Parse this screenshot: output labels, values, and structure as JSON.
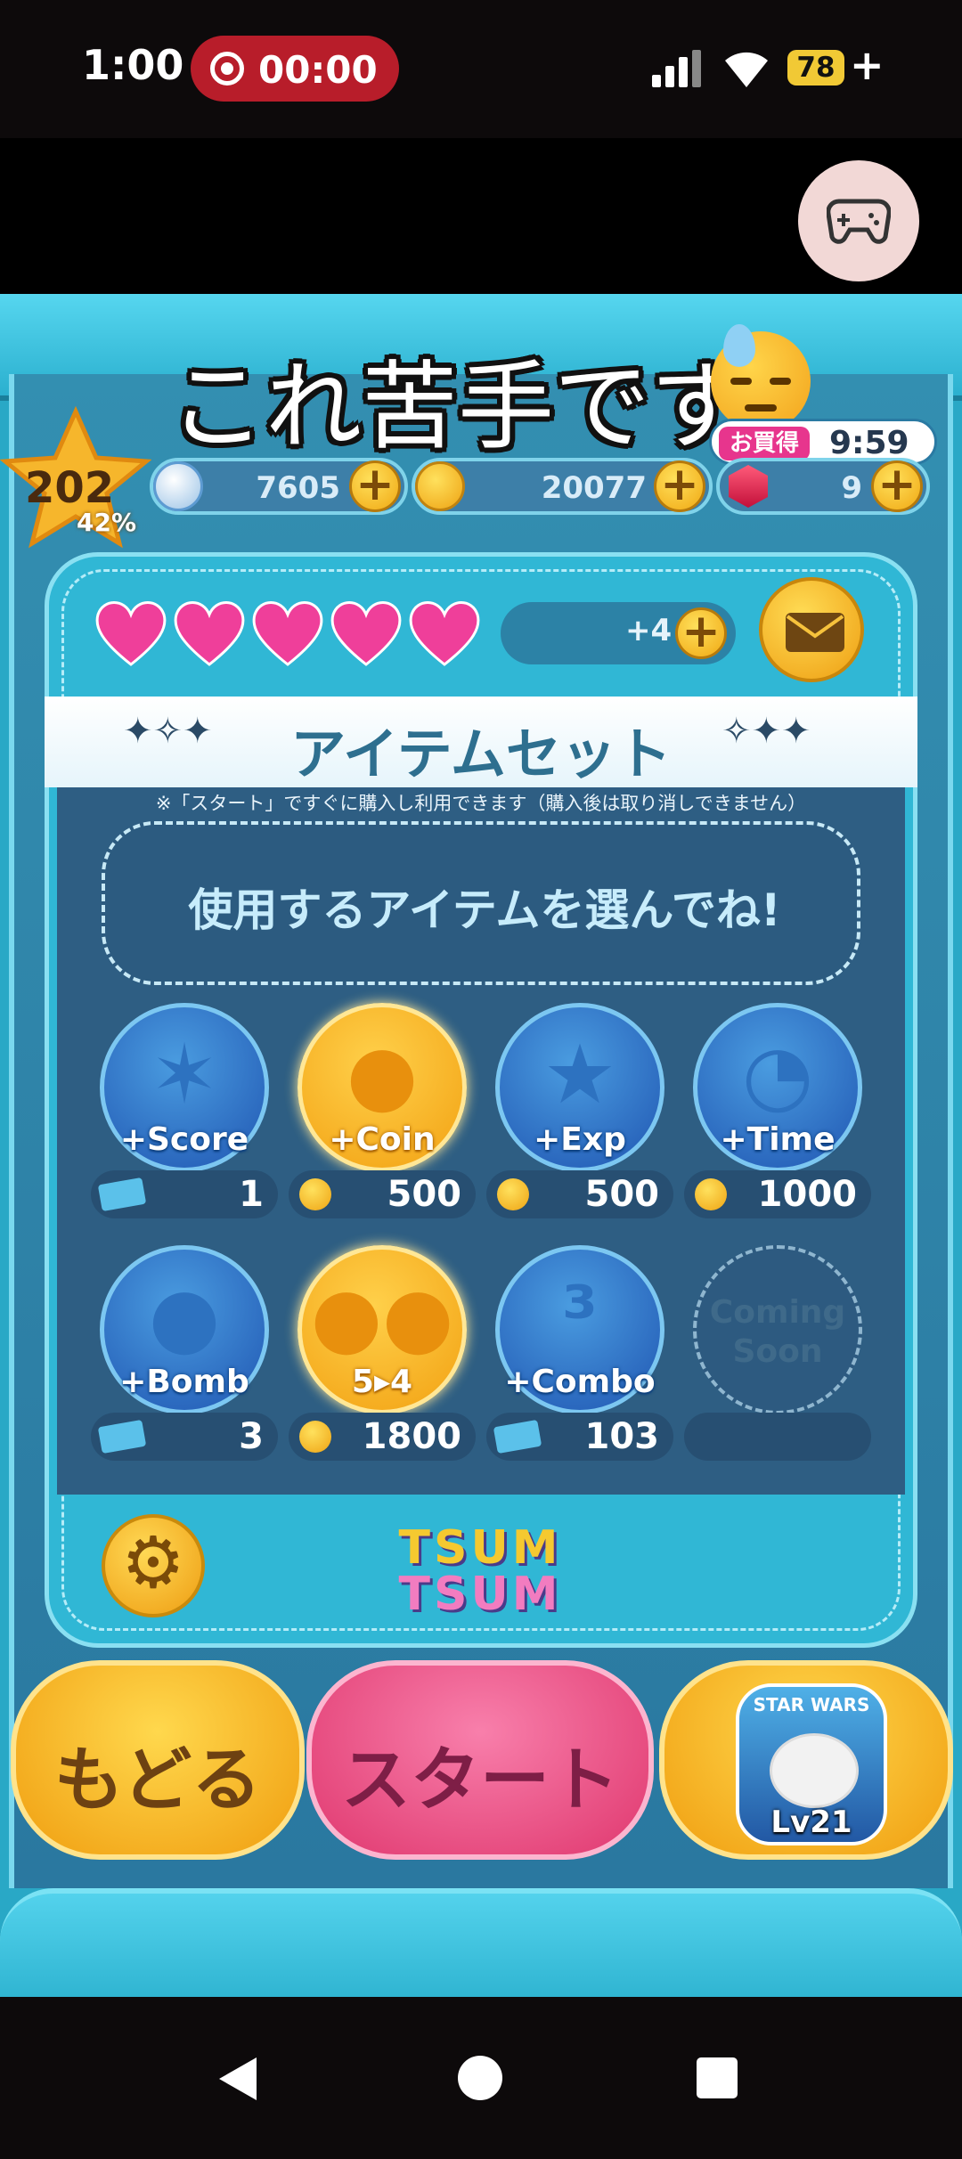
{
  "status_bar": {
    "time": "1:00",
    "recording_time": "00:00",
    "battery": "78",
    "battery_suffix": "+"
  },
  "caption": {
    "text": "これ苦手です"
  },
  "timer": {
    "tag": "お買得",
    "time": "9:59"
  },
  "level": {
    "number": "202",
    "percent": "42%"
  },
  "currencies": {
    "hearts_value": "7605",
    "coins_value": "20077",
    "rubies_value": "9"
  },
  "lives": {
    "hearts_count": 5,
    "extra": "+4"
  },
  "panel": {
    "title": "アイテムセット",
    "notice": "※「スタート」ですぐに購入し利用できます（購入後は取り消しできません）",
    "prompt": "使用するアイテムを選んでね!"
  },
  "items": [
    {
      "label": "+Score",
      "price": "1",
      "currency": "ticket",
      "selected": false,
      "glyph": "✶"
    },
    {
      "label": "+Coin",
      "price": "500",
      "currency": "coin",
      "selected": true,
      "glyph": "●"
    },
    {
      "label": "+Exp",
      "price": "500",
      "currency": "coin",
      "selected": false,
      "glyph": "★"
    },
    {
      "label": "+Time",
      "price": "1000",
      "currency": "coin",
      "selected": false,
      "glyph": "◔"
    },
    {
      "label": "+Bomb",
      "price": "3",
      "currency": "ticket",
      "selected": false,
      "glyph": "●"
    },
    {
      "label": "5▸4",
      "price": "1800",
      "currency": "coin",
      "selected": true,
      "glyph": "●●"
    },
    {
      "label": "+Combo",
      "price": "103",
      "currency": "ticket",
      "selected": false,
      "glyph": "³"
    },
    {
      "label": "Coming Soon",
      "price": "",
      "currency": "none",
      "selected": false,
      "glyph": ""
    }
  ],
  "logo": {
    "line1": "TSUM",
    "line2": "TSUM"
  },
  "buttons": {
    "back": "もどる",
    "start": "スタート",
    "tsum_title": "STAR WARS",
    "tsum_level": "Lv21"
  },
  "colors": {
    "game_bg": "#29a8c6",
    "start_pink": "#e0386f",
    "gold": "#f09e10",
    "heart_pink": "#ef3f9a"
  },
  "icons": [
    "controller-icon",
    "heart-icon",
    "coin-icon",
    "ruby-icon",
    "mail-icon",
    "gear-icon",
    "ticket-icon",
    "back-nav-icon",
    "home-nav-icon",
    "recents-nav-icon"
  ]
}
